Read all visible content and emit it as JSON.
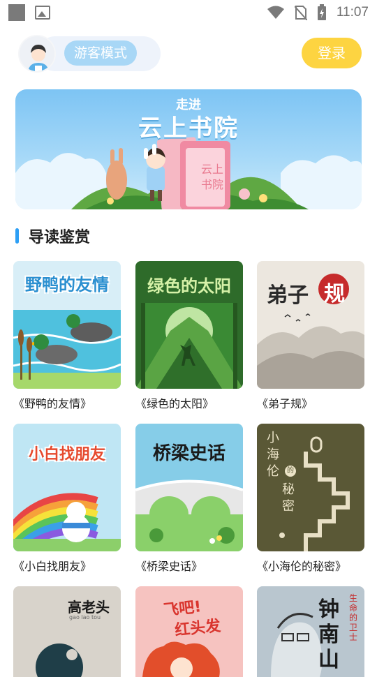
{
  "status_bar": {
    "time": "11:07"
  },
  "header": {
    "guest_label": "游客模式",
    "login_label": "登录"
  },
  "banner": {
    "subtitle": "走进",
    "title": "云上书院",
    "book_text_1": "云上",
    "book_text_2": "书院"
  },
  "section": {
    "title": "导读鉴赏"
  },
  "books": [
    {
      "title": "《野鸭的友情》",
      "cover_text": "野鸭的友情"
    },
    {
      "title": "《绿色的太阳》",
      "cover_text": "绿色的太阳"
    },
    {
      "title": "《弟子规》",
      "cover_text_a": "弟子",
      "cover_text_b": "规"
    },
    {
      "title": "《小白找朋友》",
      "cover_text": "小白找朋友"
    },
    {
      "title": "《桥梁史话》",
      "cover_text": "桥梁史话"
    },
    {
      "title": "《小海伦的秘密》",
      "cover_text_a": "小",
      "cover_text_b": "海",
      "cover_text_c": "伦",
      "cover_text_d": "的",
      "cover_text_e": "秘",
      "cover_text_f": "密"
    },
    {
      "title": "",
      "cover_text": "高老头",
      "cover_sub": "gao lao tou"
    },
    {
      "title": "",
      "cover_text_a": "飞吧!",
      "cover_text_b": "红头发"
    },
    {
      "title": "",
      "cover_text_a": "钟",
      "cover_text_b": "南",
      "cover_text_c": "山",
      "cover_text_d": "生命的卫士"
    }
  ]
}
